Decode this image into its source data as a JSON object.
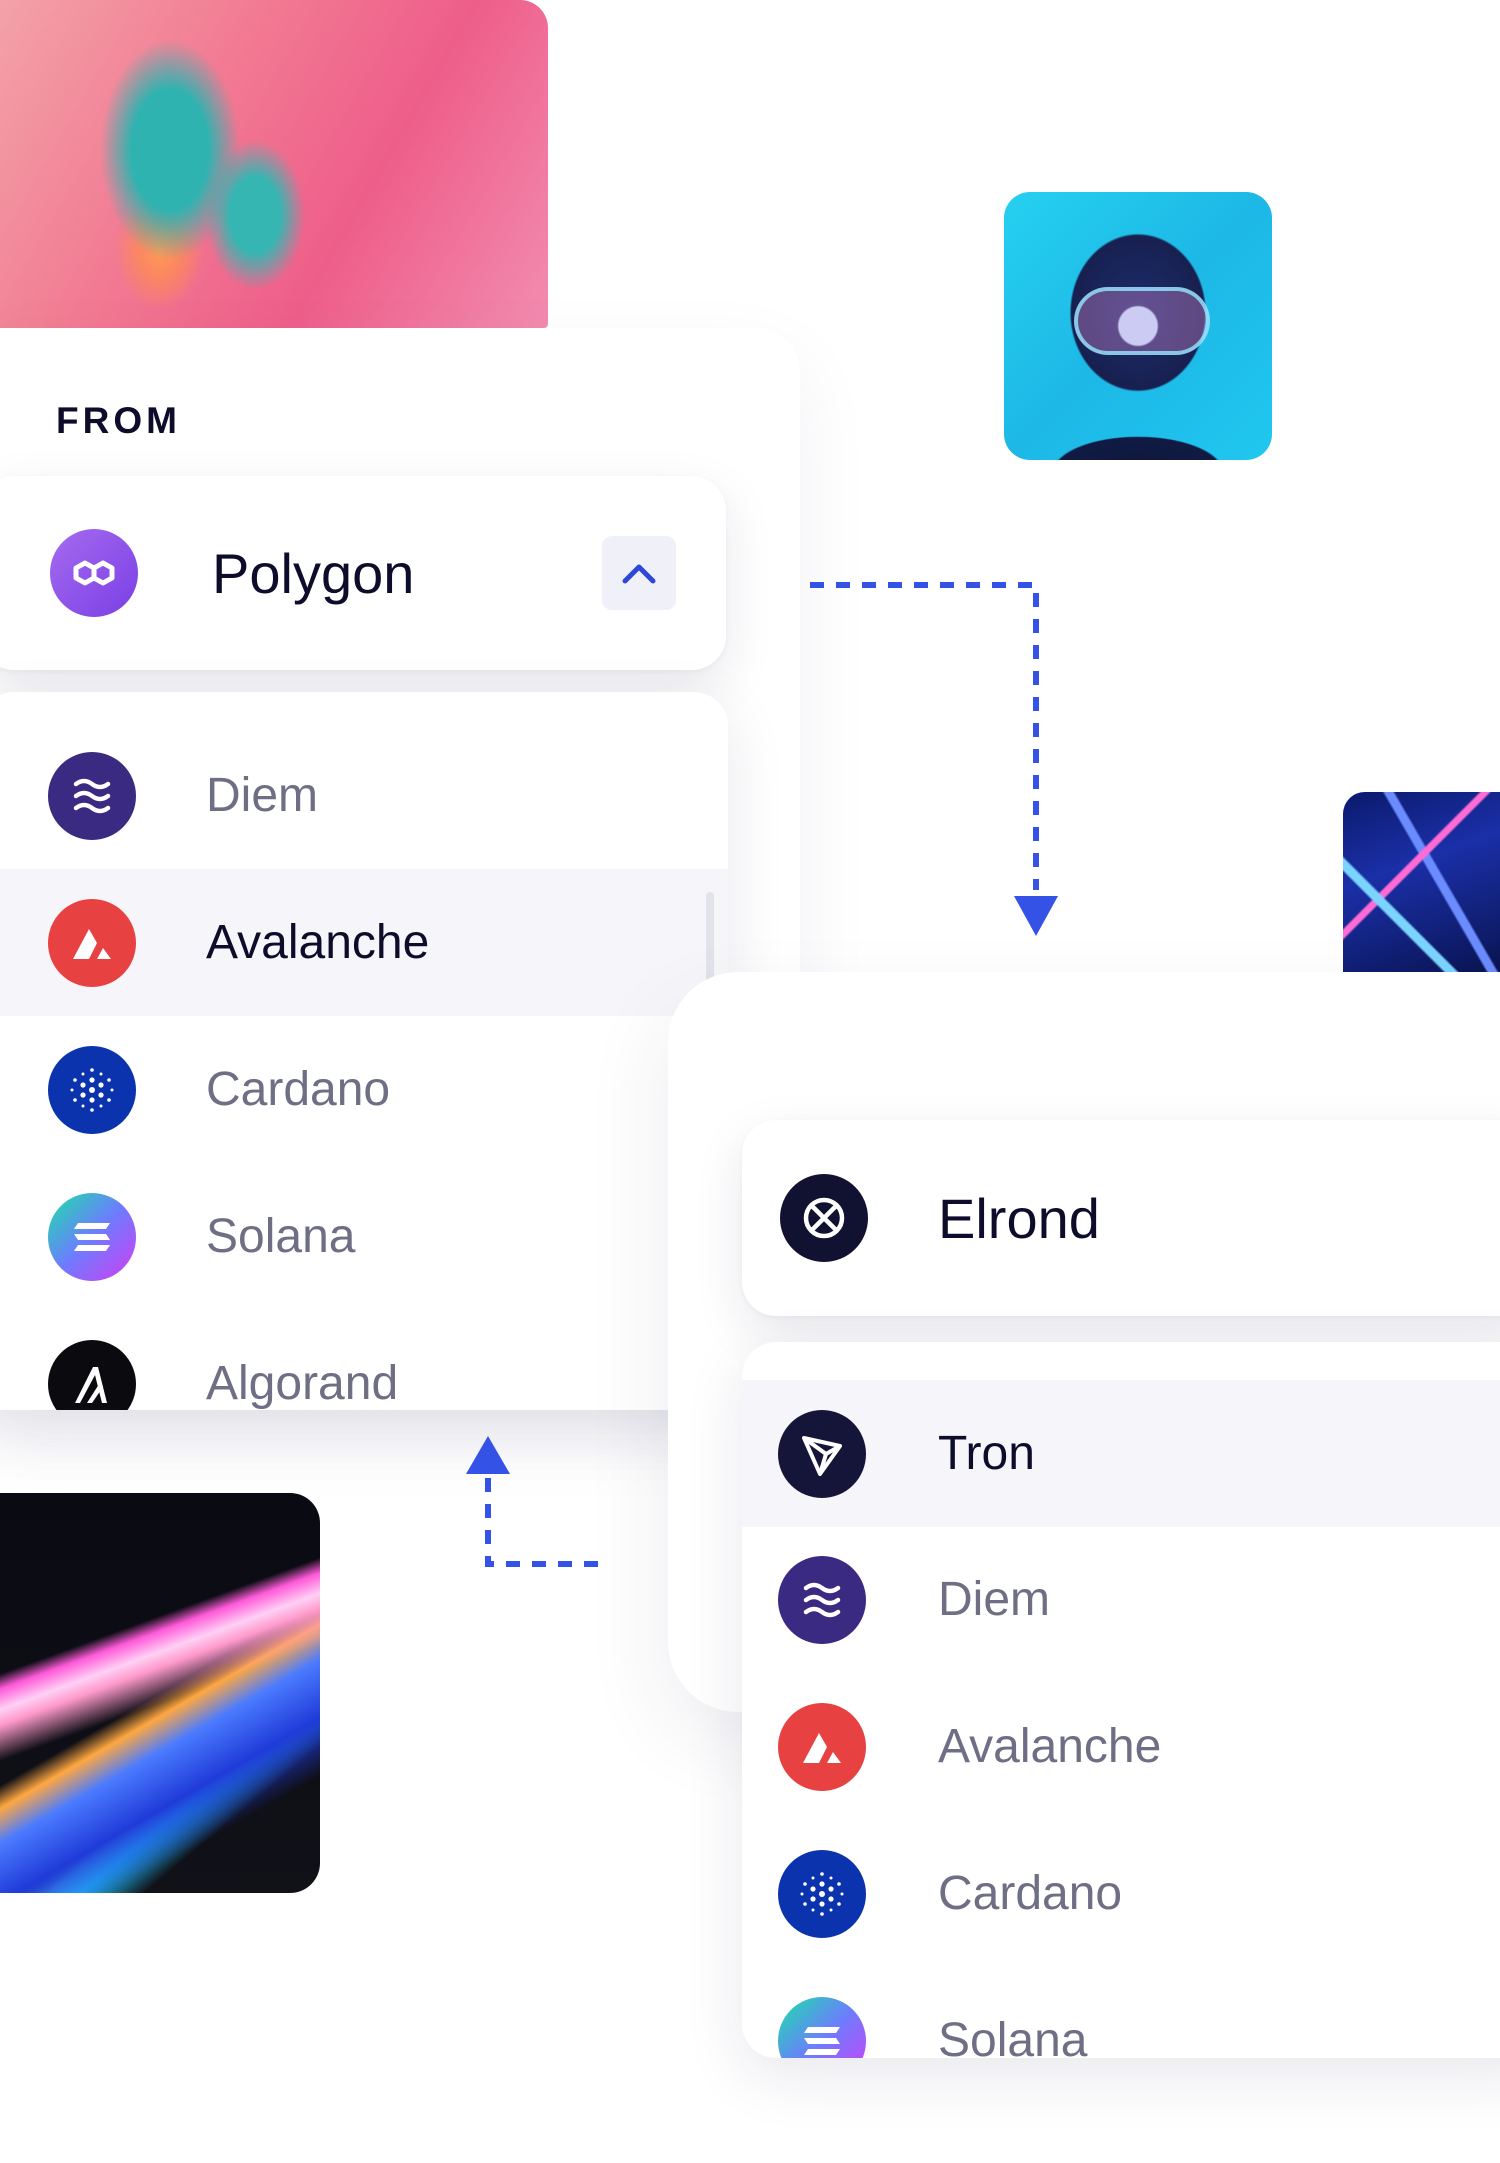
{
  "from_panel": {
    "label": "FROM",
    "selected": {
      "name": "Polygon",
      "icon": "polygon-icon"
    },
    "toggle_icon": "chevron-up-icon",
    "list": [
      {
        "name": "Diem",
        "icon": "diem-icon"
      },
      {
        "name": "Avalanche",
        "icon": "avalanche-icon",
        "highlighted": true
      },
      {
        "name": "Cardano",
        "icon": "cardano-icon"
      },
      {
        "name": "Solana",
        "icon": "solana-icon"
      },
      {
        "name": "Algorand",
        "icon": "algorand-icon"
      }
    ]
  },
  "to_panel": {
    "selected": {
      "name": "Elrond",
      "icon": "elrond-icon"
    },
    "list": [
      {
        "name": "Tron",
        "icon": "tron-icon",
        "highlighted": true
      },
      {
        "name": "Diem",
        "icon": "diem-icon"
      },
      {
        "name": "Avalanche",
        "icon": "avalanche-icon"
      },
      {
        "name": "Cardano",
        "icon": "cardano-icon"
      },
      {
        "name": "Solana",
        "icon": "solana-icon"
      }
    ]
  },
  "colors": {
    "connector": "#3452e6",
    "text_primary": "#0d0d2b",
    "text_muted": "#6e6e84",
    "row_highlight": "#f6f6fa"
  }
}
